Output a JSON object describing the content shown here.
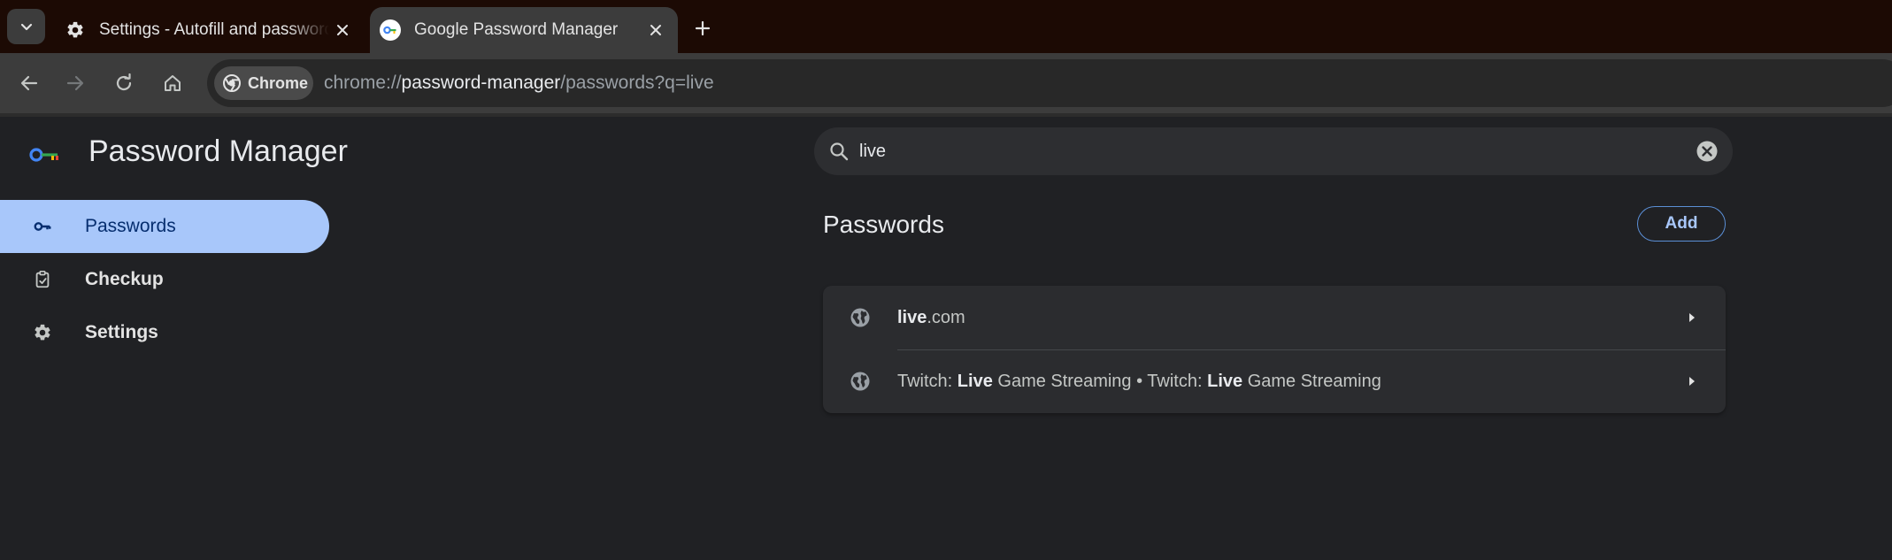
{
  "browser": {
    "tabs": [
      {
        "title": "Settings - Autofill and passwords",
        "icon": "gear-icon",
        "active": false
      },
      {
        "title": "Google Password Manager",
        "icon": "password-manager-icon",
        "active": true
      }
    ],
    "omnibox": {
      "chip_label": "Chrome",
      "url_scheme": "chrome://",
      "url_host": "password-manager",
      "url_path": "/passwords?q=live"
    }
  },
  "app": {
    "title": "Password Manager"
  },
  "sidebar": {
    "items": [
      {
        "label": "Passwords",
        "icon": "key-icon",
        "selected": true
      },
      {
        "label": "Checkup",
        "icon": "checkup-clipboard-icon",
        "selected": false
      },
      {
        "label": "Settings",
        "icon": "gear-icon",
        "selected": false
      }
    ]
  },
  "search": {
    "value": "live",
    "placeholder": "Search passwords"
  },
  "main": {
    "section_title": "Passwords",
    "add_label": "Add",
    "entries": [
      {
        "parts": [
          {
            "text": "live",
            "bold": true
          },
          {
            "text": ".com",
            "bold": false
          }
        ],
        "icon": "globe-icon"
      },
      {
        "parts": [
          {
            "text": "Twitch: ",
            "bold": false
          },
          {
            "text": "Live",
            "bold": true
          },
          {
            "text": " Game Streaming • Twitch: ",
            "bold": false
          },
          {
            "text": "Live",
            "bold": true
          },
          {
            "text": " Game Streaming",
            "bold": false
          }
        ],
        "icon": "globe-icon"
      }
    ]
  },
  "colors": {
    "tabstrip_bg": "#1c0a04",
    "toolbar_bg": "#3c3c3c",
    "page_bg": "#202124",
    "accent": "#a8c7fa"
  }
}
